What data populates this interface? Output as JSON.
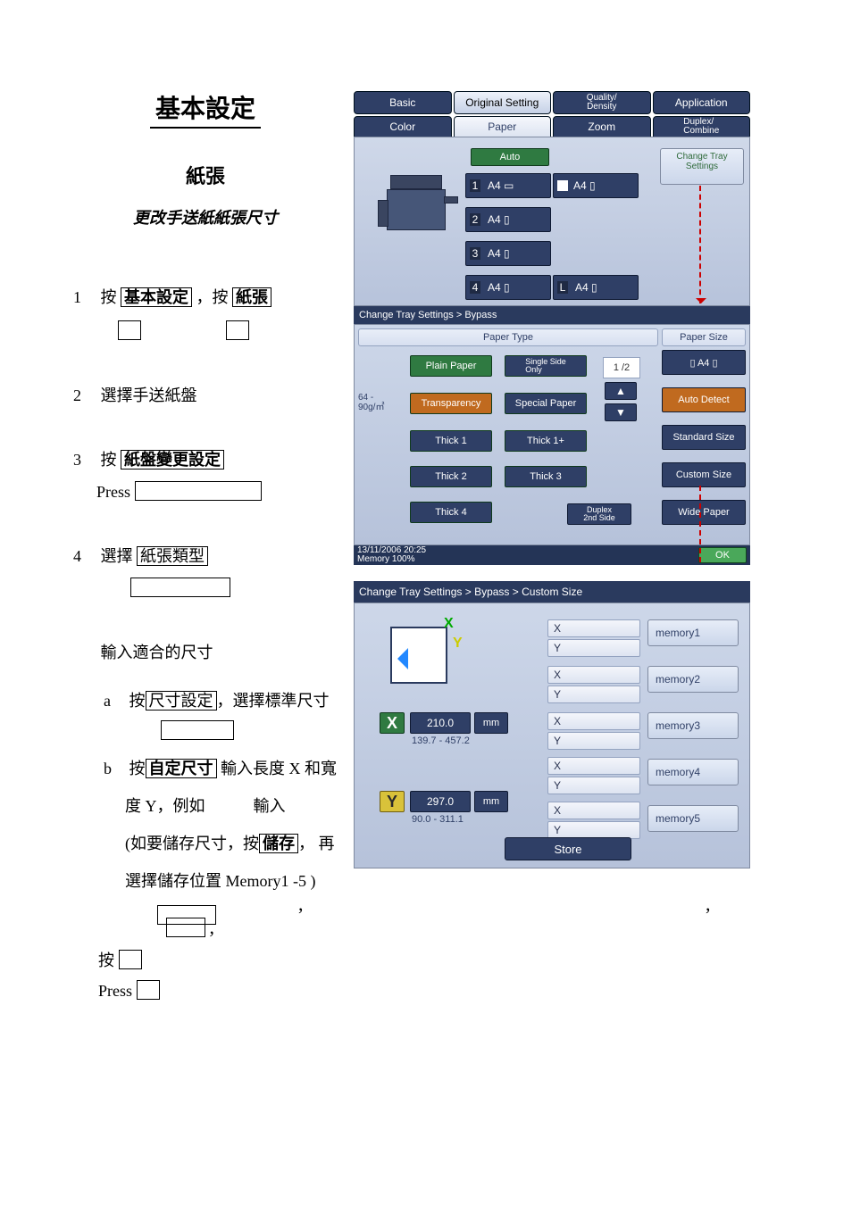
{
  "heading": {
    "title": "基本設定",
    "subtitle": "紙張",
    "subtitle2": "更改手送紙紙張尺寸"
  },
  "steps": {
    "s1_pre": "按",
    "s1_b1": "基本設定",
    "s1_mid": "，按",
    "s1_b2": "紙張",
    "s2": "選擇手送紙盤",
    "s3_pre": "按",
    "s3_b1": "紙盤變更設定",
    "s3_press": "Press",
    "s4_pre": "選擇",
    "s4_b1": "紙張類型",
    "s5": "輸入適合的尺寸",
    "a_letter": "a",
    "a_pre": "按",
    "a_b1": "尺寸設定",
    "a_post": "，選擇標準尺寸",
    "b_letter": "b",
    "b_pre": "按",
    "b_b1": "自定尺寸",
    "b_mid": " 輸入長度 X 和寬",
    "b_line2": "度 Y，例如　　　輸入",
    "b_line3_pre": "(如要儲存尺寸，按",
    "b_line3_b": "儲存",
    "b_line3_post": "，  再",
    "b_line4": "選擇儲存位置 Memory1 -5 )",
    "press": "按",
    "pressEn": "Press"
  },
  "tabs": {
    "basic": "Basic",
    "original": "Original Setting",
    "quality": "Quality/\nDensity",
    "application": "Application"
  },
  "tabs2": {
    "color": "Color",
    "paper": "Paper",
    "zoom": "Zoom",
    "duplex": "Duplex/\nCombine"
  },
  "trays": {
    "auto": "Auto",
    "t1": "A4 ▭",
    "t2": "A4 ▯",
    "t3": "A4 ▯",
    "t4": "A4 ▯",
    "r1": "A4 ▯",
    "r4": "A4 ▯",
    "change": "Change Tray\nSettings"
  },
  "bc1": "Change Tray Settings > Bypass",
  "paperType": {
    "hdrType": "Paper Type",
    "hdrSize": "Paper Size",
    "plain": "Plain Paper",
    "single": "Single Side\nOnly",
    "page": "1 /2",
    "gsm": "64 -\n90g/㎡",
    "transparency": "Transparency",
    "special": "Special Paper",
    "thick1": "Thick 1",
    "thick1p": "Thick 1+",
    "thick2": "Thick 2",
    "thick3": "Thick 3",
    "thick4": "Thick 4",
    "dup2": "Duplex\n2nd Side",
    "szA4": "▯ A4 ▯",
    "auto": "Auto Detect",
    "std": "Standard Size",
    "custom": "Custom Size",
    "wide": "Wide Paper"
  },
  "status": {
    "date": "13/11/2006    20:25",
    "mem": "Memory      100%",
    "ok": "OK"
  },
  "bc2": "Change Tray Settings > Bypass > Custom Size",
  "custom": {
    "X": "X",
    "Y": "Y",
    "xVal": "210.0",
    "mm": "mm",
    "xRange": "139.7  -    457.2",
    "yVal": "297.0",
    "yRange": "90.0  -    311.1",
    "mem1": "memory1",
    "mem2": "memory2",
    "mem3": "memory3",
    "mem4": "memory4",
    "mem5": "memory5",
    "store": "Store"
  }
}
